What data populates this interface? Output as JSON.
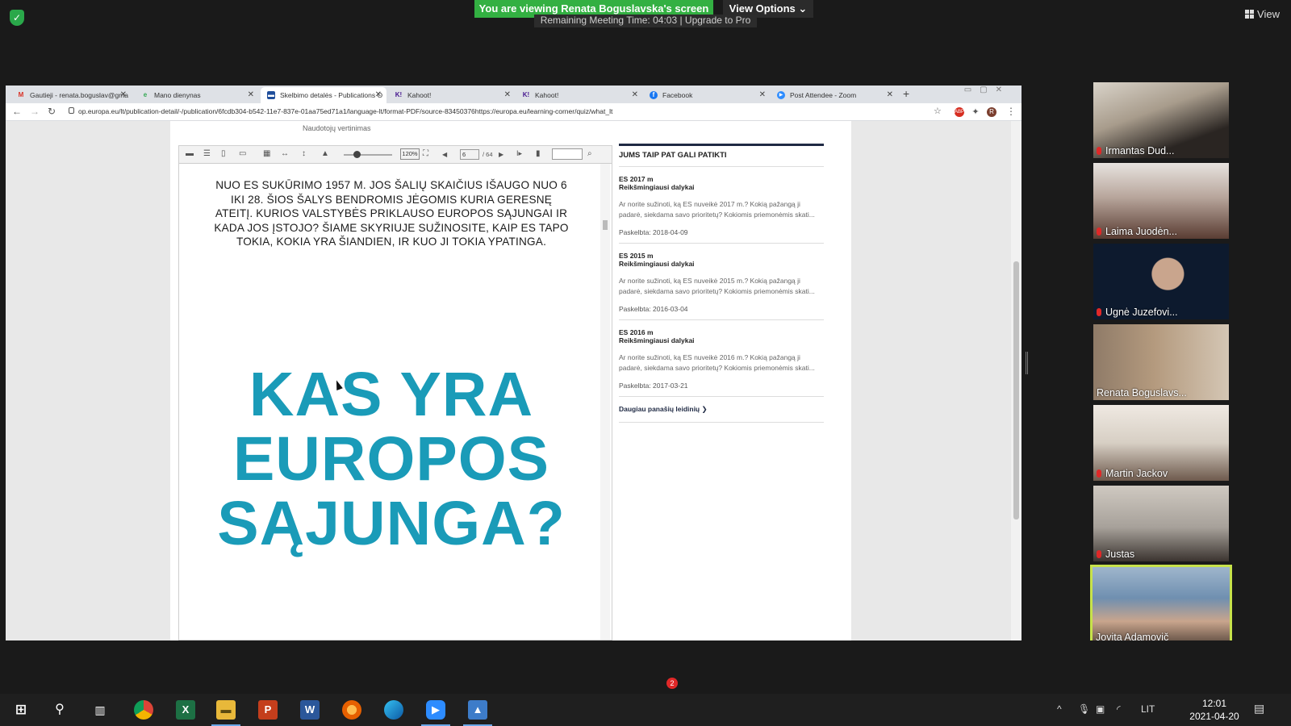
{
  "zoom": {
    "banner": "You are viewing Renata Boguslavska's screen",
    "view_options": "View Options",
    "remaining": "Remaining Meeting Time: 04:03 | Upgrade to Pro",
    "view_label": "View",
    "chat_badge": "2"
  },
  "browser": {
    "tabs": [
      {
        "label": "Gautieji - renata.boguslav@gma",
        "icon": "gmail-icon",
        "color": "#d93025",
        "glyph": "M"
      },
      {
        "label": "Mano dienynas",
        "icon": "diary-icon",
        "color": "#34a853",
        "glyph": "e"
      },
      {
        "label": "Skelbimo detalės - Publications O",
        "icon": "eu-publications-icon",
        "color": "#1f4e9b",
        "glyph": "▬"
      },
      {
        "label": "Kahoot!",
        "icon": "kahoot-icon",
        "color": "#46178f",
        "glyph": "K!"
      },
      {
        "label": "Kahoot!",
        "icon": "kahoot-icon",
        "color": "#46178f",
        "glyph": "K!"
      },
      {
        "label": "Facebook",
        "icon": "facebook-icon",
        "color": "#1877f2",
        "glyph": "f"
      },
      {
        "label": "Post Attendee - Zoom",
        "icon": "zoom-icon",
        "color": "#2d8cff",
        "glyph": "▶"
      }
    ],
    "url": "op.europa.eu/lt/publication-detail/-/publication/6fcdb304-b542-11e7-837e-01aa75ed71a1/language-lt/format-PDF/source-83450376https://europa.eu/learning-corner/quiz/what_lt",
    "profile_initial": "R"
  },
  "document": {
    "user_rating": "Naudotojų vertinimas",
    "zoom_level": "120%",
    "page_current": "6",
    "page_total": "/ 64",
    "intro": "NUO ES SUKŪRIMO 1957 M. JOS ŠALIŲ SKAIČIUS IŠAUGO NUO 6 IKI 28. ŠIOS ŠALYS BENDROMIS JĖGOMIS KURIA GERESNĘ ATEITĮ. KURIOS VALSTYBĖS PRIKLAUSO EUROPOS SĄJUNGAI IR KADA JOS ĮSTOJO? ŠIAME SKYRIUJE SUŽINOSITE, KAIP ES TAPO TOKIA, KOKIA YRA ŠIANDIEN, IR KUO JI TOKIA YPATINGA.",
    "title_lines": [
      "KAS YRA",
      "EUROPOS",
      "SĄJUNGA?"
    ]
  },
  "sidebar": {
    "heading": "JUMS TAIP PAT GALI PATIKTI",
    "items": [
      {
        "year": "ES 2017 m",
        "subtitle": "Reikšmingiausi dalykai",
        "desc": "Ar norite sužinoti, ką ES nuveikė 2017 m.? Kokią pažangą ji padarė, siekdama savo prioritetų? Kokiomis priemonėmis skati...",
        "date": "Paskelbta: 2018-04-09"
      },
      {
        "year": "ES 2015 m",
        "subtitle": "Reikšmingiausi dalykai",
        "desc": "Ar norite sužinoti, ką ES nuveikė 2015 m.? Kokią pažangą ji padarė, siekdama savo prioritetų? Kokiomis priemonėmis skati...",
        "date": "Paskelbta: 2016-03-04"
      },
      {
        "year": "ES 2016 m",
        "subtitle": "Reikšmingiausi dalykai",
        "desc": "Ar norite sužinoti, ką ES nuveikė 2016 m.? Kokią pažangą ji padarė, siekdama savo prioritetų? Kokiomis priemonėmis skati...",
        "date": "Paskelbta: 2017-03-21"
      }
    ],
    "more": "Daugiau panašių leidinių"
  },
  "participants": [
    {
      "name": "Irmantas Dud...",
      "muted": true,
      "bg": "#a89c8c"
    },
    {
      "name": "Laima Juodėn...",
      "muted": true,
      "bg": "#7d6b62"
    },
    {
      "name": "Ugnė Juzefovi...",
      "muted": true,
      "bg": "#0d1a2e"
    },
    {
      "name": "Renata Boguslavs...",
      "muted": false,
      "bg": "#b49a7e"
    },
    {
      "name": "Martin Jackov",
      "muted": true,
      "bg": "#d7cfc4"
    },
    {
      "name": "Justas",
      "muted": true,
      "bg": "#a7a19a"
    },
    {
      "name": "Jovita Adamovič",
      "muted": false,
      "bg": "#6f8fb0"
    }
  ],
  "taskbar": {
    "language": "LIT",
    "time": "12:01",
    "date": "2021-04-20"
  },
  "colors": {
    "zoom_green": "#33b042",
    "title_teal": "#1a9bb8",
    "active_speaker": "#c7e24a"
  }
}
